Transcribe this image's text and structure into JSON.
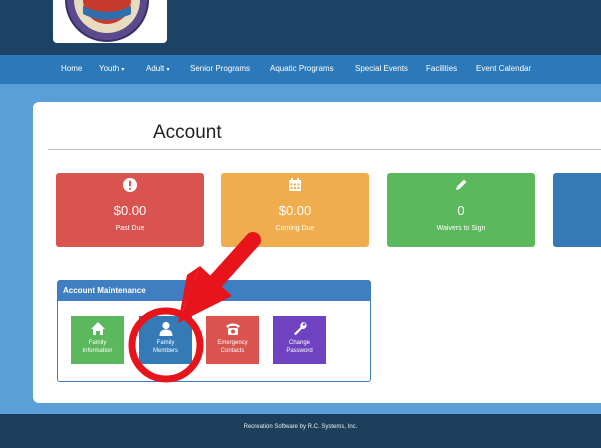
{
  "nav": {
    "items": [
      {
        "label": "Home"
      },
      {
        "label": "Youth",
        "caret": "▾"
      },
      {
        "label": "Adult",
        "caret": "▾"
      },
      {
        "label": "Senior Programs"
      },
      {
        "label": "Aquatic Programs"
      },
      {
        "label": "Special Events"
      },
      {
        "label": "Facilities"
      },
      {
        "label": "Event Calendar"
      }
    ]
  },
  "page": {
    "title": "Account"
  },
  "summary_tiles": [
    {
      "icon": "exclamation-icon",
      "amount": "$0.00",
      "label": "Past Due",
      "color": "#d9534f"
    },
    {
      "icon": "calendar-icon",
      "amount": "$0.00",
      "label": "Coming Due",
      "color": "#f0ad4e"
    },
    {
      "icon": "pencil-icon",
      "amount": "0",
      "label": "Waivers to Sign",
      "color": "#5cb85c"
    },
    {
      "icon": "",
      "amount": "",
      "label": "",
      "color": "#337ab7"
    }
  ],
  "maintenance": {
    "title": "Account Maintenance",
    "buttons": [
      {
        "icon": "home-icon",
        "line1": "Family",
        "line2": "Information",
        "color": "#5cb85c"
      },
      {
        "icon": "user-icon",
        "line1": "Family",
        "line2": "Members",
        "color": "#337ab7"
      },
      {
        "icon": "phone-icon",
        "line1": "Emergency",
        "line2": "Contacts",
        "color": "#d9534f"
      },
      {
        "icon": "wrench-icon",
        "line1": "Change",
        "line2": "Password",
        "color": "#6f42c1"
      }
    ]
  },
  "annotation": {
    "color": "#e8141c"
  },
  "footer": {
    "text": "Recreation Software by R.C. Systems, Inc."
  }
}
